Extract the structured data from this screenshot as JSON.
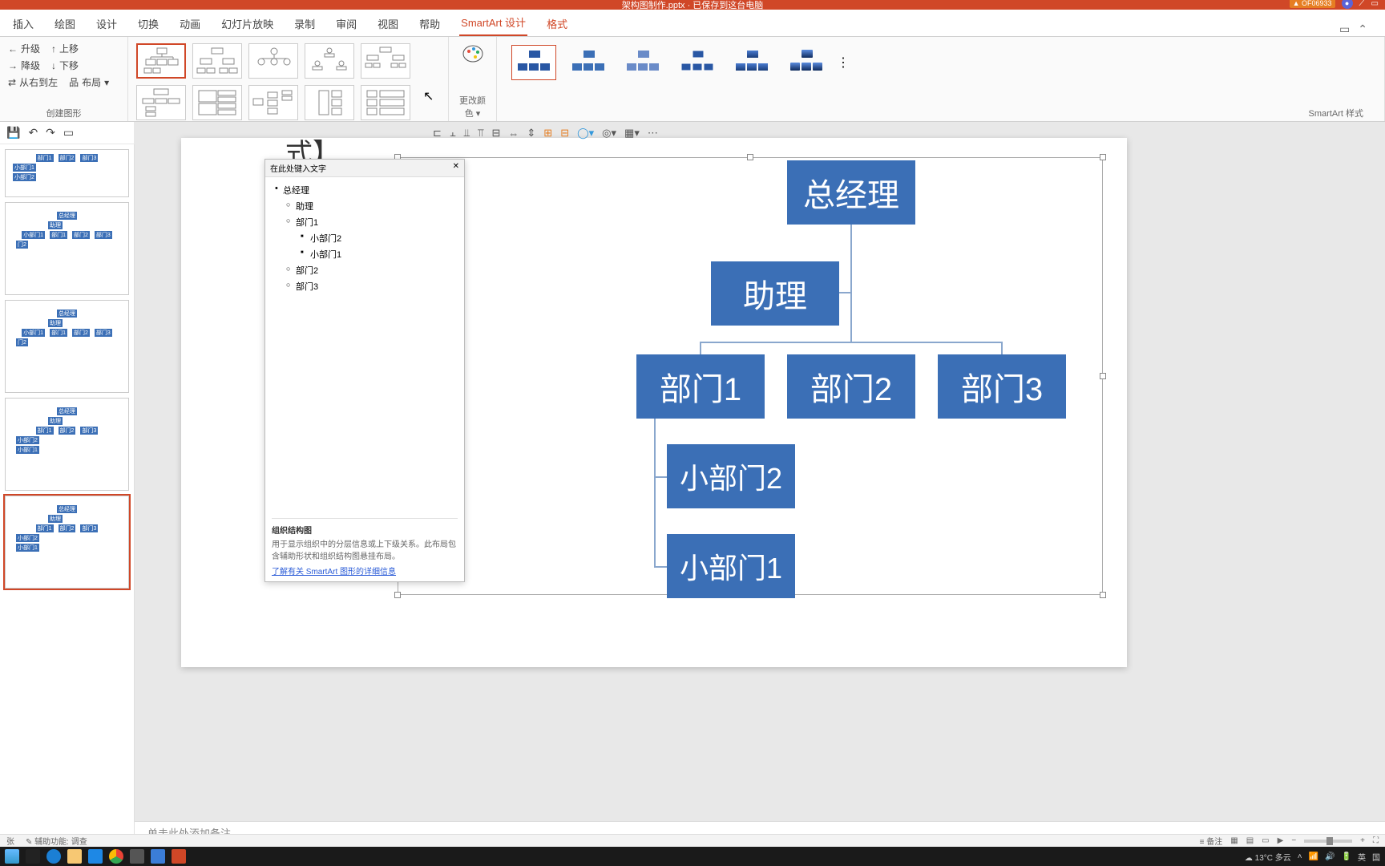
{
  "titlebar": {
    "filename": "架构图制作.pptx · 已保存到这台电脑",
    "user": "OF06933"
  },
  "tabs": {
    "insert": "插入",
    "draw": "绘图",
    "design": "设计",
    "transition": "切换",
    "anim": "动画",
    "slideshow": "幻灯片放映",
    "record": "录制",
    "review": "审阅",
    "view": "视图",
    "help": "帮助",
    "smartart": "SmartArt 设计",
    "format": "格式"
  },
  "ribbon": {
    "promote": "升级",
    "demote": "降级",
    "moveup": "上移",
    "movedown": "下移",
    "rtl": "从右到左",
    "layout": "布局",
    "create_label": "创建图形",
    "colors": "更改颜色",
    "styles_label": "SmartArt 样式"
  },
  "textpane": {
    "title": "在此处键入文字",
    "items": {
      "i0": "总经理",
      "i1": "助理",
      "i2": "部门1",
      "i3": "小部门2",
      "i4": "小部门1",
      "i5": "部门2",
      "i6": "部门3"
    },
    "footer_title": "组织结构图",
    "footer_desc": "用于显示组织中的分层信息或上下级关系。此布局包含辅助形状和组织结构图悬挂布局。",
    "footer_link": "了解有关 SmartArt 图形的详细信息"
  },
  "chart": {
    "mgr": "总经理",
    "asst": "助理",
    "d1": "部门1",
    "d2": "部门2",
    "d3": "部门3",
    "s2": "小部门2",
    "s1": "小部门1"
  },
  "slide_title_partial": "式】",
  "notes": "单击此处添加备注",
  "status": {
    "left1": "张",
    "left2": "辅助功能: 调查",
    "notes_btn": "备注"
  },
  "taskbar": {
    "weather": "13°C 多云",
    "ime": "英",
    "time_area": "国"
  }
}
